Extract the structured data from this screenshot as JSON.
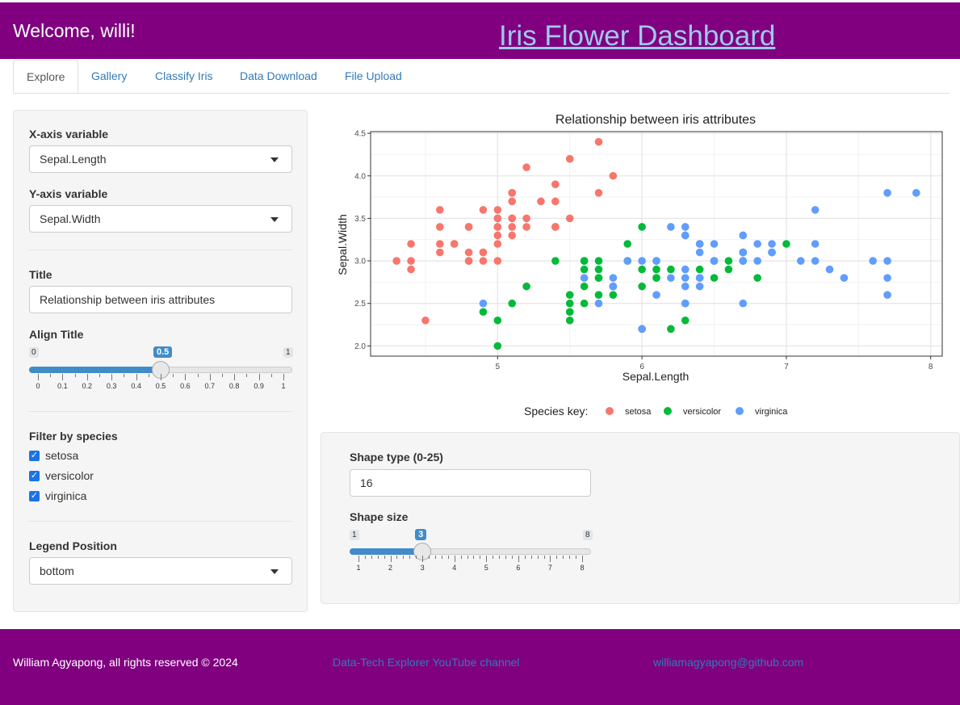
{
  "header": {
    "welcome": "Welcome, willi!",
    "title": "Iris Flower Dashboard"
  },
  "tabs": [
    {
      "label": "Explore",
      "active": true
    },
    {
      "label": "Gallery"
    },
    {
      "label": "Classify Iris"
    },
    {
      "label": "Data Download"
    },
    {
      "label": "File Upload"
    }
  ],
  "sidebar": {
    "x_label": "X-axis variable",
    "x_value": "Sepal.Length",
    "y_label": "Y-axis variable",
    "y_value": "Sepal.Width",
    "title_label": "Title",
    "title_value": "Relationship between iris attributes",
    "align_label": "Align Title",
    "align_slider": {
      "min": "0",
      "max": "1",
      "value": "0.5",
      "value_num": 0.5,
      "ticks": [
        "0",
        "0.1",
        "0.2",
        "0.3",
        "0.4",
        "0.5",
        "0.6",
        "0.7",
        "0.8",
        "0.9",
        "1"
      ]
    },
    "filter_label": "Filter by species",
    "species": [
      {
        "label": "setosa",
        "checked": true
      },
      {
        "label": "versicolor",
        "checked": true
      },
      {
        "label": "virginica",
        "checked": true
      }
    ],
    "legend_label": "Legend Position",
    "legend_value": "bottom"
  },
  "shape_panel": {
    "type_label": "Shape type (0-25)",
    "type_value": "16",
    "size_label": "Shape size",
    "size_slider": {
      "min": "1",
      "max": "8",
      "value": "3",
      "value_num": 3,
      "ticks": [
        "1",
        "2",
        "3",
        "4",
        "5",
        "6",
        "7",
        "8"
      ]
    }
  },
  "footer": {
    "copyright": "William Agyapong, all rights reserved © 2024",
    "youtube": "Data-Tech Explorer YouTube channel",
    "email": "williamagyapong@github.com"
  },
  "colors": {
    "brand": "#800080",
    "setosa": "#F8766D",
    "versicolor": "#00BA38",
    "virginica": "#619CFF",
    "accent": "#428bca"
  },
  "chart_data": {
    "type": "scatter",
    "title": "Relationship between iris attributes",
    "xlabel": "Sepal.Length",
    "ylabel": "Sepal.Width",
    "xlim": [
      4.3,
      7.9
    ],
    "ylim": [
      2.0,
      4.4
    ],
    "xticks": [
      "5",
      "6",
      "7",
      "8"
    ],
    "yticks": [
      "2.0",
      "2.5",
      "3.0",
      "3.5",
      "4.0",
      "4.5"
    ],
    "legend_title": "Species key:",
    "legend_position": "bottom",
    "series": [
      {
        "name": "setosa",
        "color": "#F8766D",
        "points": [
          [
            5.1,
            3.5
          ],
          [
            4.9,
            3.0
          ],
          [
            4.7,
            3.2
          ],
          [
            4.6,
            3.1
          ],
          [
            5.0,
            3.6
          ],
          [
            5.4,
            3.9
          ],
          [
            4.6,
            3.4
          ],
          [
            5.0,
            3.4
          ],
          [
            4.4,
            2.9
          ],
          [
            4.9,
            3.1
          ],
          [
            5.4,
            3.7
          ],
          [
            4.8,
            3.4
          ],
          [
            4.8,
            3.0
          ],
          [
            4.3,
            3.0
          ],
          [
            5.8,
            4.0
          ],
          [
            5.7,
            4.4
          ],
          [
            5.4,
            3.9
          ],
          [
            5.1,
            3.5
          ],
          [
            5.7,
            3.8
          ],
          [
            5.1,
            3.8
          ],
          [
            5.4,
            3.4
          ],
          [
            5.1,
            3.7
          ],
          [
            4.6,
            3.6
          ],
          [
            5.1,
            3.3
          ],
          [
            4.8,
            3.4
          ],
          [
            5.0,
            3.0
          ],
          [
            5.0,
            3.4
          ],
          [
            5.2,
            3.5
          ],
          [
            5.2,
            3.4
          ],
          [
            4.7,
            3.2
          ],
          [
            4.8,
            3.1
          ],
          [
            5.4,
            3.4
          ],
          [
            5.2,
            4.1
          ],
          [
            5.5,
            4.2
          ],
          [
            4.9,
            3.1
          ],
          [
            5.0,
            3.2
          ],
          [
            5.5,
            3.5
          ],
          [
            4.9,
            3.6
          ],
          [
            4.4,
            3.0
          ],
          [
            5.1,
            3.4
          ],
          [
            5.0,
            3.5
          ],
          [
            4.5,
            2.3
          ],
          [
            4.4,
            3.2
          ],
          [
            5.0,
            3.5
          ],
          [
            5.1,
            3.8
          ],
          [
            4.8,
            3.0
          ],
          [
            5.1,
            3.8
          ],
          [
            4.6,
            3.2
          ],
          [
            5.3,
            3.7
          ],
          [
            5.0,
            3.3
          ]
        ]
      },
      {
        "name": "versicolor",
        "color": "#00BA38",
        "points": [
          [
            7.0,
            3.2
          ],
          [
            6.4,
            3.2
          ],
          [
            6.9,
            3.1
          ],
          [
            5.5,
            2.3
          ],
          [
            6.5,
            2.8
          ],
          [
            5.7,
            2.8
          ],
          [
            6.3,
            3.3
          ],
          [
            4.9,
            2.4
          ],
          [
            6.6,
            2.9
          ],
          [
            5.2,
            2.7
          ],
          [
            5.0,
            2.0
          ],
          [
            5.9,
            3.0
          ],
          [
            6.0,
            2.2
          ],
          [
            6.1,
            2.9
          ],
          [
            5.6,
            2.9
          ],
          [
            6.7,
            3.1
          ],
          [
            5.6,
            3.0
          ],
          [
            5.8,
            2.7
          ],
          [
            6.2,
            2.2
          ],
          [
            5.6,
            2.5
          ],
          [
            5.9,
            3.2
          ],
          [
            6.1,
            2.8
          ],
          [
            6.3,
            2.5
          ],
          [
            6.1,
            2.8
          ],
          [
            6.4,
            2.9
          ],
          [
            6.6,
            3.0
          ],
          [
            6.8,
            2.8
          ],
          [
            6.7,
            3.0
          ],
          [
            6.0,
            2.9
          ],
          [
            5.7,
            2.6
          ],
          [
            5.5,
            2.4
          ],
          [
            5.5,
            2.4
          ],
          [
            5.8,
            2.7
          ],
          [
            6.0,
            2.7
          ],
          [
            5.4,
            3.0
          ],
          [
            6.0,
            3.4
          ],
          [
            6.7,
            3.1
          ],
          [
            6.3,
            2.3
          ],
          [
            5.6,
            3.0
          ],
          [
            5.5,
            2.5
          ],
          [
            5.5,
            2.6
          ],
          [
            6.1,
            3.0
          ],
          [
            5.8,
            2.6
          ],
          [
            5.0,
            2.3
          ],
          [
            5.6,
            2.7
          ],
          [
            5.7,
            3.0
          ],
          [
            5.7,
            2.9
          ],
          [
            6.2,
            2.9
          ],
          [
            5.1,
            2.5
          ],
          [
            5.7,
            2.8
          ]
        ]
      },
      {
        "name": "virginica",
        "color": "#619CFF",
        "points": [
          [
            6.3,
            3.3
          ],
          [
            5.8,
            2.7
          ],
          [
            7.1,
            3.0
          ],
          [
            6.3,
            2.9
          ],
          [
            6.5,
            3.0
          ],
          [
            7.6,
            3.0
          ],
          [
            4.9,
            2.5
          ],
          [
            7.3,
            2.9
          ],
          [
            6.7,
            2.5
          ],
          [
            7.2,
            3.6
          ],
          [
            6.5,
            3.2
          ],
          [
            6.4,
            2.7
          ],
          [
            6.8,
            3.0
          ],
          [
            5.7,
            2.5
          ],
          [
            5.8,
            2.8
          ],
          [
            6.4,
            3.2
          ],
          [
            6.5,
            3.0
          ],
          [
            7.7,
            3.8
          ],
          [
            7.7,
            2.6
          ],
          [
            6.0,
            2.2
          ],
          [
            6.9,
            3.2
          ],
          [
            5.6,
            2.8
          ],
          [
            7.7,
            2.8
          ],
          [
            6.3,
            2.7
          ],
          [
            6.7,
            3.3
          ],
          [
            7.2,
            3.2
          ],
          [
            6.2,
            2.8
          ],
          [
            6.1,
            3.0
          ],
          [
            6.4,
            2.8
          ],
          [
            7.2,
            3.0
          ],
          [
            7.4,
            2.8
          ],
          [
            7.9,
            3.8
          ],
          [
            6.4,
            2.8
          ],
          [
            6.3,
            2.8
          ],
          [
            6.1,
            2.6
          ],
          [
            7.7,
            3.0
          ],
          [
            6.3,
            3.4
          ],
          [
            6.4,
            3.1
          ],
          [
            6.0,
            3.0
          ],
          [
            6.9,
            3.1
          ],
          [
            6.7,
            3.1
          ],
          [
            6.9,
            3.1
          ],
          [
            5.8,
            2.7
          ],
          [
            6.8,
            3.2
          ],
          [
            6.7,
            3.3
          ],
          [
            6.7,
            3.0
          ],
          [
            6.3,
            2.5
          ],
          [
            6.5,
            3.0
          ],
          [
            6.2,
            3.4
          ],
          [
            5.9,
            3.0
          ]
        ]
      }
    ]
  }
}
